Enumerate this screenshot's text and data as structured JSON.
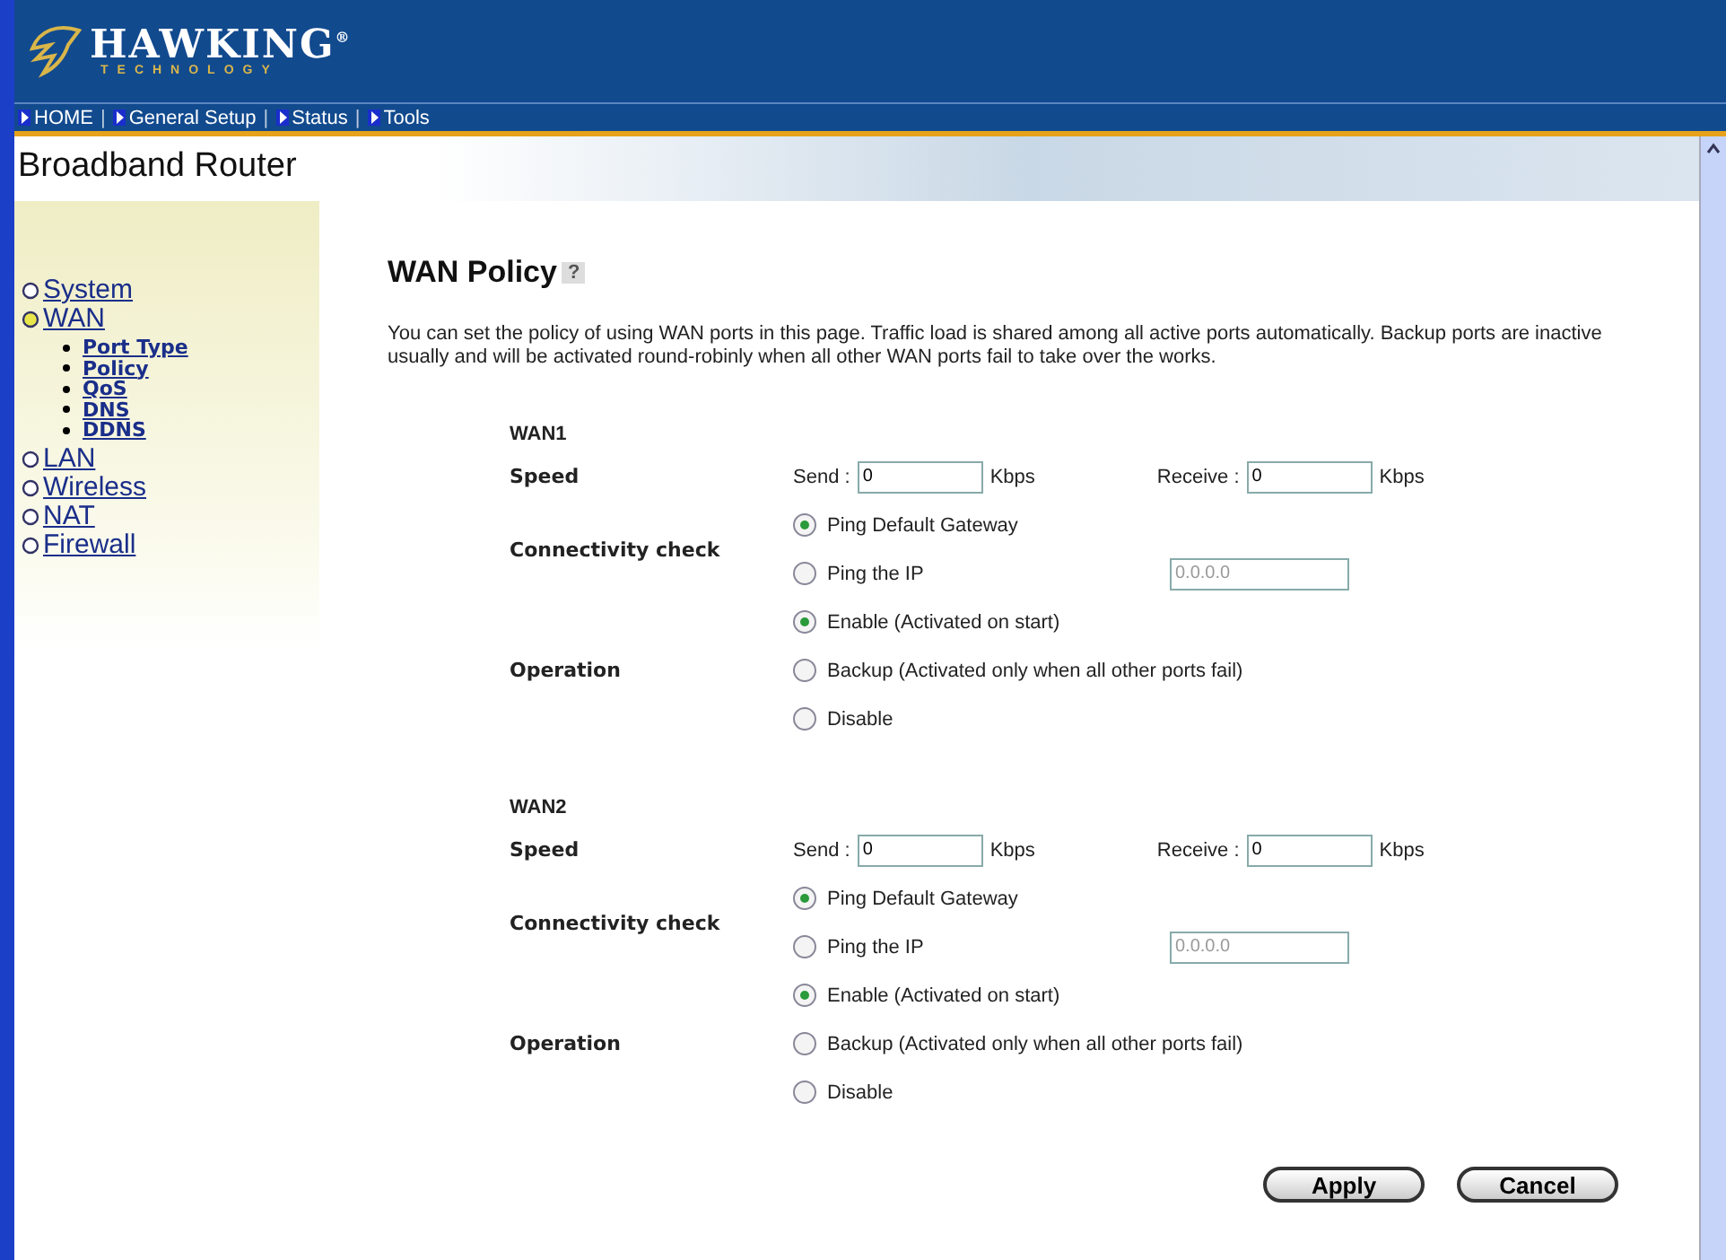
{
  "logo": {
    "name": "HAWKING",
    "tagline": "TECHNOLOGY",
    "mark": "®"
  },
  "nav": [
    {
      "label": "HOME"
    },
    {
      "separator": "|",
      "label": "General Setup"
    },
    {
      "separator": "|",
      "label": "Status"
    },
    {
      "separator": "|",
      "label": "Tools"
    }
  ],
  "product": "Broadband Router",
  "sidebar": [
    {
      "label": "System",
      "selected": false
    },
    {
      "label": "WAN",
      "selected": true,
      "children": [
        {
          "label": "Port Type"
        },
        {
          "label": "Policy"
        },
        {
          "label": "QoS"
        },
        {
          "label": "DNS"
        },
        {
          "label": "DDNS"
        }
      ]
    },
    {
      "label": "LAN",
      "selected": false
    },
    {
      "label": "Wireless",
      "selected": false
    },
    {
      "label": "NAT",
      "selected": false
    },
    {
      "label": "Firewall",
      "selected": false
    }
  ],
  "page": {
    "title": "WAN Policy",
    "help": "?",
    "description": "You can set the policy of using WAN ports in this page. Traffic load is shared among all active ports automatically. Backup ports are inactive usually and will be activated round-robinly when all other WAN ports fail to take over the works."
  },
  "ports": [
    {
      "name": "WAN1",
      "speed_label": "Speed",
      "send_label": "Send :",
      "send": "0",
      "send_unit": "Kbps",
      "receive_label": "Receive :",
      "receive": "0",
      "receive_unit": "Kbps",
      "check_label": "Connectivity check",
      "check_options": [
        {
          "label": "Ping Default Gateway",
          "selected": true
        },
        {
          "label": "Ping the IP",
          "selected": false
        }
      ],
      "ip": {
        "value": "0.0.0.0",
        "disabled": true
      },
      "operation_label": "Operation",
      "operation_options": [
        {
          "label": "Enable (Activated on start)",
          "selected": true
        },
        {
          "label": "Backup (Activated only when all other ports fail)",
          "selected": false
        },
        {
          "label": "Disable",
          "selected": false
        }
      ]
    },
    {
      "name": "WAN2",
      "speed_label": "Speed",
      "send_label": "Send :",
      "send": "0",
      "send_unit": "Kbps",
      "receive_label": "Receive :",
      "receive": "0",
      "receive_unit": "Kbps",
      "check_label": "Connectivity check",
      "check_options": [
        {
          "label": "Ping Default Gateway",
          "selected": true
        },
        {
          "label": "Ping the IP",
          "selected": false
        }
      ],
      "ip": {
        "value": "0.0.0.0",
        "disabled": true
      },
      "operation_label": "Operation",
      "operation_options": [
        {
          "label": "Enable (Activated on start)",
          "selected": true
        },
        {
          "label": "Backup (Activated only when all other ports fail)",
          "selected": false
        },
        {
          "label": "Disable",
          "selected": false
        }
      ]
    }
  ],
  "buttons": [
    {
      "label": "Apply"
    },
    {
      "label": "Cancel"
    }
  ]
}
